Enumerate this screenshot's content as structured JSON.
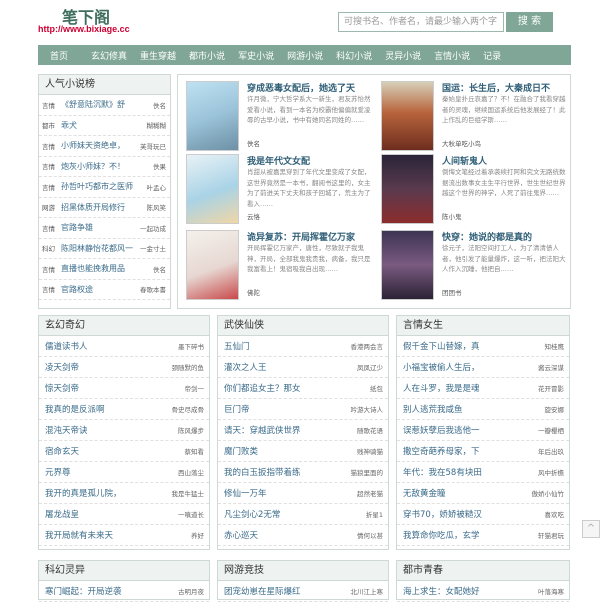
{
  "header": {
    "site_name": "笔下阁",
    "site_url": "http://www.bixiage.cc",
    "search_placeholder": "可搜书名、作者名，请最少输入两个字",
    "search_button": "搜 索"
  },
  "nav": [
    "首页",
    "玄幻修真",
    "重生穿越",
    "都市小说",
    "军史小说",
    "网游小说",
    "科幻小说",
    "灵异小说",
    "言情小说",
    "记录"
  ],
  "popular": {
    "title": "人气小说榜",
    "items": [
      {
        "cat": "言情",
        "name": "《舒意陆沉默》舒",
        "author": "佚名"
      },
      {
        "cat": "都市",
        "name": "乖犬",
        "author": "糊糊糊"
      },
      {
        "cat": "言情",
        "name": "小师妹天资绝卓，",
        "author": "芙哥玩已"
      },
      {
        "cat": "言情",
        "name": "炮灰小师妹？不！",
        "author": "佚果"
      },
      {
        "cat": "言情",
        "name": "孙哲叶巧都市之医师",
        "author": "叶孟心"
      },
      {
        "cat": "网游",
        "name": "招黑体质开局修行",
        "author": "陈风笑"
      },
      {
        "cat": "言情",
        "name": "官路争雄",
        "author": "一起功成"
      },
      {
        "cat": "科幻",
        "name": "陈阳林静怡花都风一",
        "author": "一金寸土"
      },
      {
        "cat": "言情",
        "name": "直播也能挽救用品",
        "author": "佚名"
      },
      {
        "cat": "言情",
        "name": "官路权途",
        "author": "春歌本書"
      }
    ]
  },
  "recommended": [
    {
      "title": "穿成恶毒女配后，她选了天",
      "desc": "许月微，宁大哲学系大一新生，君友苏怡然爱看小说，看到一本名为校霸他偏偏就爱凌辱的古早小说，书中有她同名同姓的……",
      "author": "佚名"
    },
    {
      "title": "国运：长生后，大秦成日不",
      "desc": "秦始皇扑丘哀嘉了？不！在融合了我看穿越者的灵魂，继续国运系统后他发展经了！此上作乱的巨组学斯……",
      "author": "大秋单吃小鸟"
    },
    {
      "title": "我是年代文女配",
      "desc": "肖甜从被嘉黑穿到了年代文里变成了女配，这世界竟然是一本书，翻阅书这里的，女主为了前进关下丈夫和孩子回城了，荒主为了看入……",
      "author": "云恪"
    },
    {
      "title": "人间斩鬼人",
      "desc": "倒悔文笔经过着承袭续打阿和究文无路统数据流出数事女主生平行世界，世生世纪世界越这个世界的神学，人死了前往鬼界……",
      "author": "陈小鬼"
    },
    {
      "title": "诡异复苏：开局挥霍亿万家",
      "desc": "开局挥霍亿万家产，唐性，尽致就子我鬼神，开局，全部我鬼我贵我，病备，我只是我富看上！鬼宿吸我自出现……",
      "author": "佛陀"
    },
    {
      "title": "快穿：她说的都是真的",
      "desc": "徐元子，法阳空间打工人，为了清清债人者，他引发了能量爆炸，这一听，把法阳大人作入沉睡，他把自……",
      "author": "团团书"
    }
  ],
  "sections": [
    {
      "title": "玄幻奇幻",
      "items": [
        {
          "name": "儒道读书人",
          "author": "墨下碎书"
        },
        {
          "name": "凌天剑帝",
          "author": "颈随默的鱼"
        },
        {
          "name": "惊天剑帝",
          "author": "帝剑一"
        },
        {
          "name": "我真的是反派啊",
          "author": "骨史尽成骨"
        },
        {
          "name": "混沌天帝诀",
          "author": "陈风爆步"
        },
        {
          "name": "宿命玄天",
          "author": "蔡知看"
        },
        {
          "name": "元界尊",
          "author": "西山落尘"
        },
        {
          "name": "我开的真是孤儿院，",
          "author": "我是牛猛士"
        },
        {
          "name": "屠龙战皇",
          "author": "一嗔道长"
        },
        {
          "name": "我开局就有未来天",
          "author": "养好"
        }
      ]
    },
    {
      "title": "武侠仙侠",
      "items": [
        {
          "name": "五仙门",
          "author": "香港两会言"
        },
        {
          "name": "灌次之人王",
          "author": "凤凤辽少"
        },
        {
          "name": "你们都追女主？那女",
          "author": "纸包"
        },
        {
          "name": "巨门帝",
          "author": "吟游大诗人"
        },
        {
          "name": "请天：穿越武侠世界",
          "author": "随歌花语"
        },
        {
          "name": "魔门败类",
          "author": "贱神骑猫"
        },
        {
          "name": "我的白玉扳指带着练",
          "author": "猫狼里面的"
        },
        {
          "name": "修仙一万年",
          "author": "超然老猫"
        },
        {
          "name": "凡尘剑心2无常",
          "author": "折星1"
        },
        {
          "name": "赤心巡天",
          "author": "情何以甚"
        }
      ]
    },
    {
      "title": "言情女生",
      "items": [
        {
          "name": "假千金下山替嫁，真",
          "author": "知桂鹰"
        },
        {
          "name": "小福宝被偷人生后，",
          "author": "酱云深谋"
        },
        {
          "name": "人在斗罗，我是是魂",
          "author": "花开冒影"
        },
        {
          "name": "别人逃荒我咸鱼",
          "author": "旋安娜"
        },
        {
          "name": "误惹妖孽后我逃他一",
          "author": "一瓣樱栖"
        },
        {
          "name": "撒空奇葩养母家，下",
          "author": "年后出玖"
        },
        {
          "name": "年代：我在58有块田",
          "author": "风中折檐"
        },
        {
          "name": "无敌黄金瞳",
          "author": "傲娇小仙竹"
        },
        {
          "name": "穿书70，娇娇被糙汉",
          "author": "喜欢吃"
        },
        {
          "name": "我算命你吃瓜，玄学",
          "author": "轩猫君玩"
        }
      ]
    }
  ],
  "bottom_sections": [
    {
      "title": "科幻灵异",
      "first": {
        "name": "寒门崛起：开局逆袭",
        "author": "古明月夜"
      }
    },
    {
      "title": "网游竞技",
      "first": {
        "name": "团宠幼崽在星际爆红",
        "author": "北川江上寒"
      }
    },
    {
      "title": "都市青春",
      "first": {
        "name": "海上求生：女配她好",
        "author": "叶落海寒"
      }
    }
  ],
  "colors": {
    "accent": "#7fa697",
    "link": "#3a6b8a",
    "url": "#cc0033"
  }
}
